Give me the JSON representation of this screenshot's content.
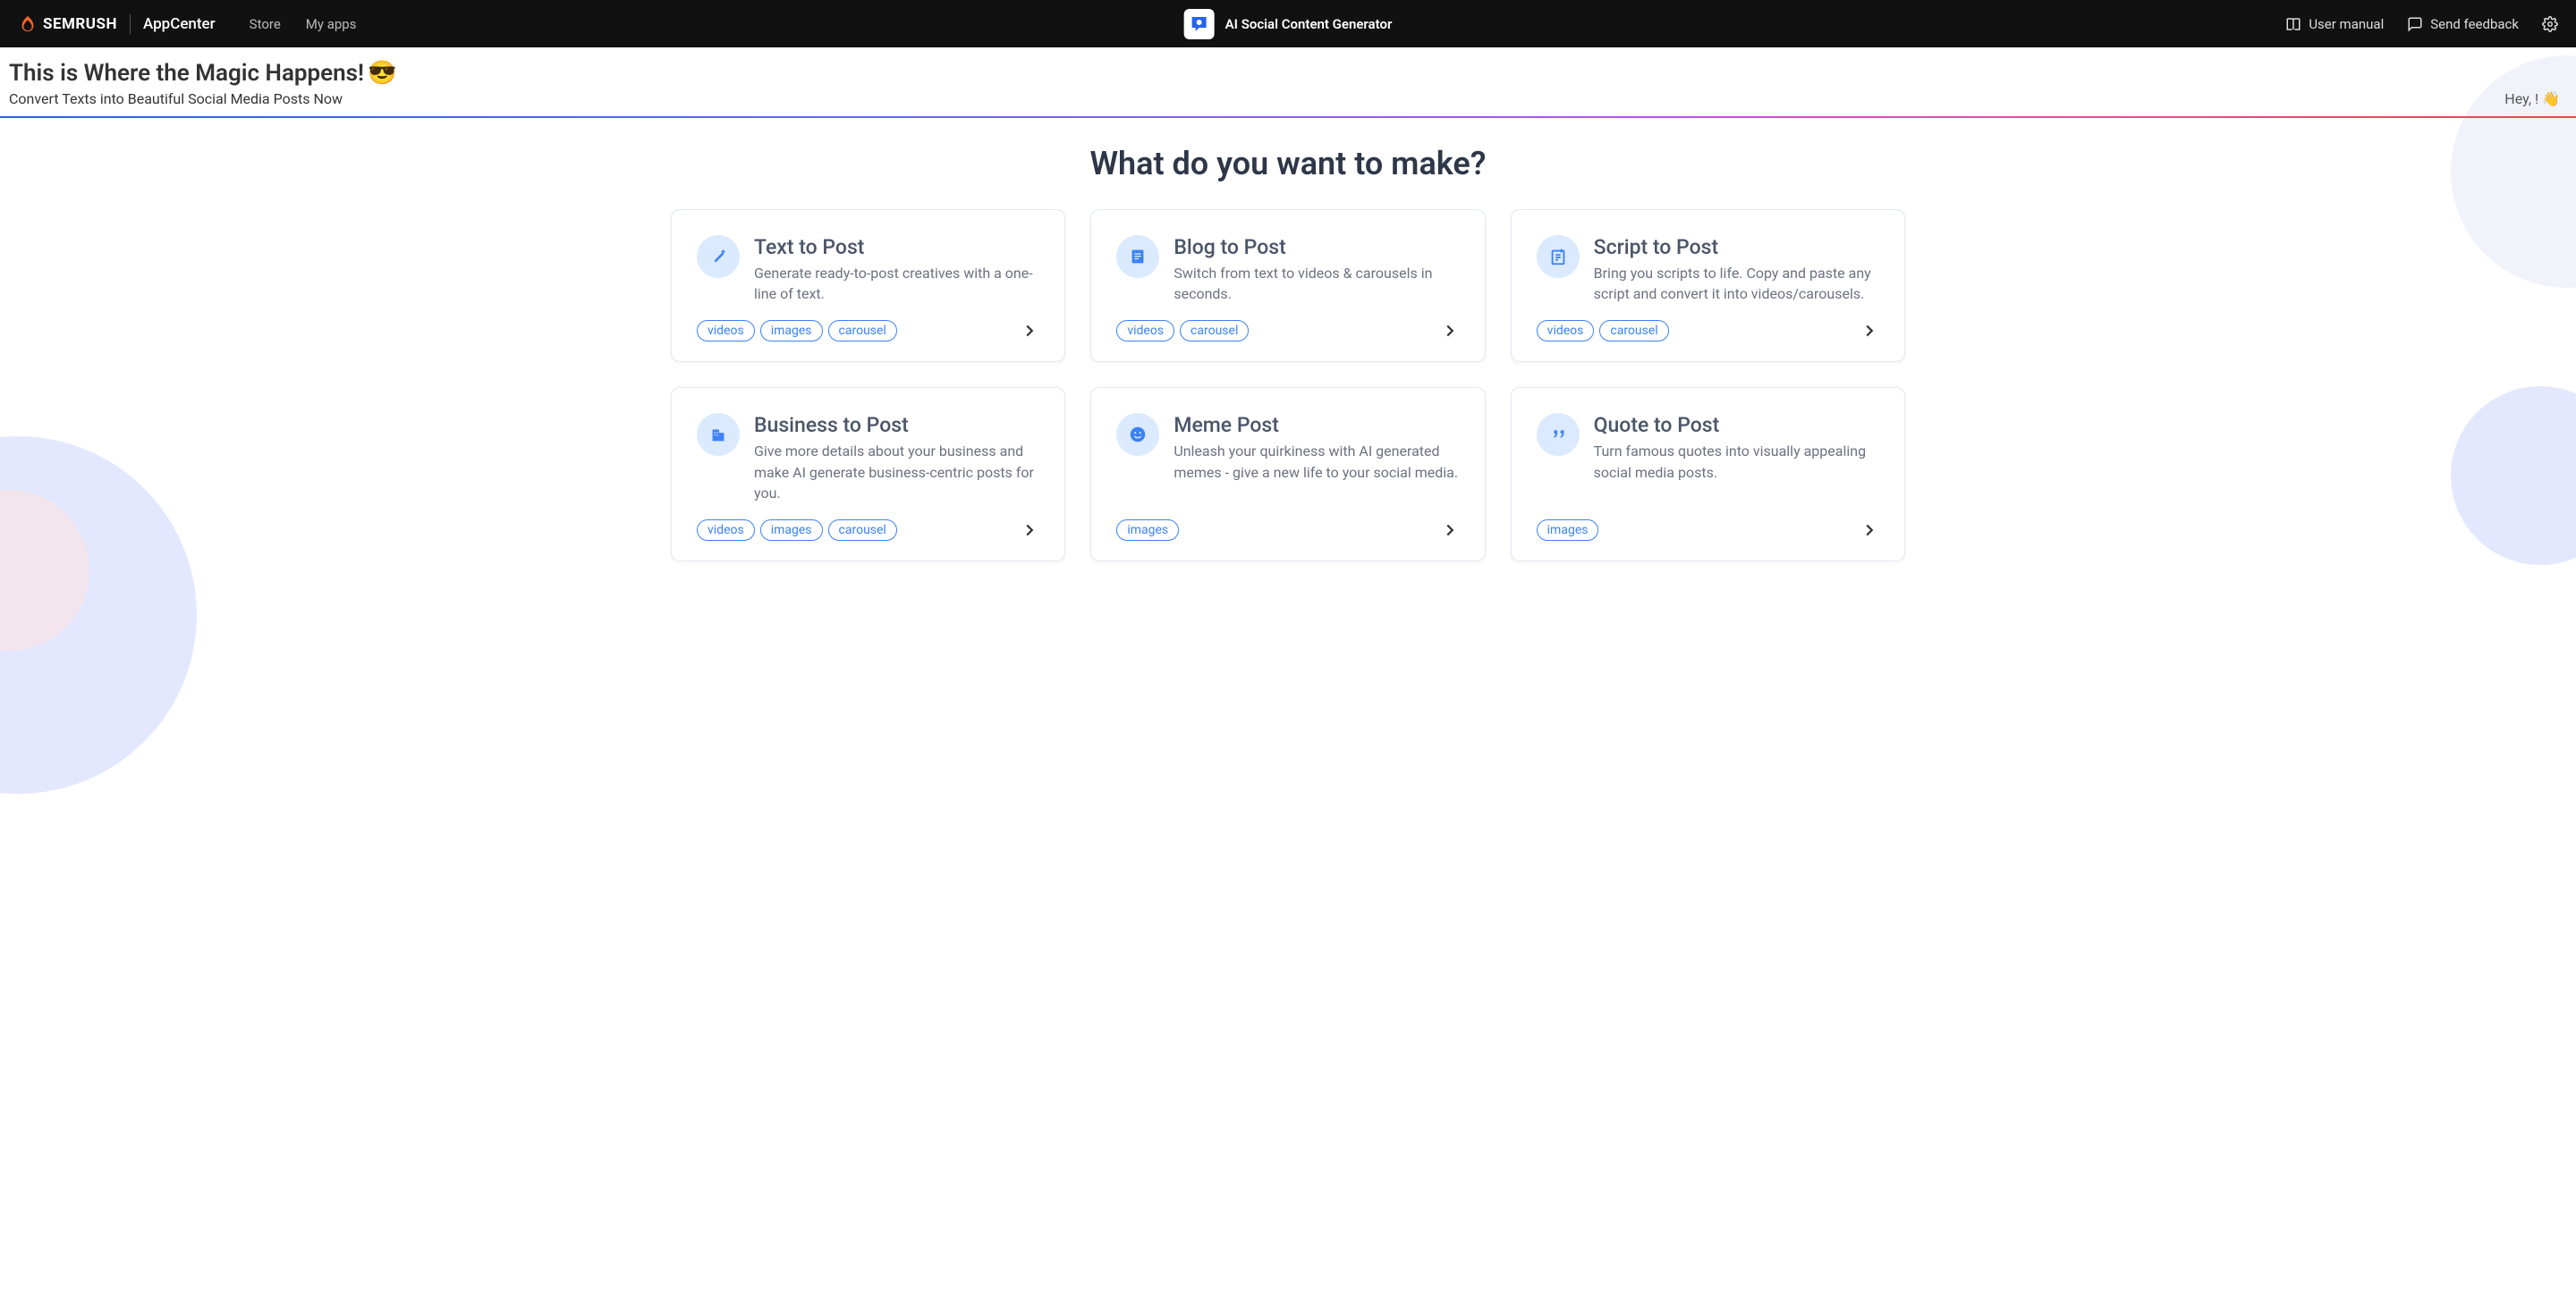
{
  "header": {
    "brand": "SEMRUSH",
    "appcenter": "AppCenter",
    "nav": {
      "store": "Store",
      "myapps": "My apps"
    },
    "app_name": "AI Social Content Generator",
    "user_manual": "User manual",
    "send_feedback": "Send feedback"
  },
  "hero": {
    "title": "This is Where the Magic Happens!",
    "emoji": "😎",
    "subtitle": "Convert Texts into Beautiful Social Media Posts Now",
    "greeting": "Hey, !",
    "greeting_emoji": "👋"
  },
  "main": {
    "heading": "What do you want to make?"
  },
  "cards": [
    {
      "title": "Text to Post",
      "desc": "Generate ready-to-post creatives with a one-line of text.",
      "tags": [
        "videos",
        "images",
        "carousel"
      ]
    },
    {
      "title": "Blog to Post",
      "desc": "Switch from text to videos & carousels in seconds.",
      "tags": [
        "videos",
        "carousel"
      ]
    },
    {
      "title": "Script to Post",
      "desc": "Bring you scripts to life. Copy and paste any script and convert it into videos/carousels.",
      "tags": [
        "videos",
        "carousel"
      ]
    },
    {
      "title": "Business to Post",
      "desc": "Give more details about your business and make AI generate business-centric posts for you.",
      "tags": [
        "videos",
        "images",
        "carousel"
      ]
    },
    {
      "title": "Meme Post",
      "desc": "Unleash your quirkiness with AI generated memes - give a new life to your social media.",
      "tags": [
        "images"
      ]
    },
    {
      "title": "Quote to Post",
      "desc": "Turn famous quotes into visually appealing social media posts.",
      "tags": [
        "images"
      ]
    }
  ]
}
